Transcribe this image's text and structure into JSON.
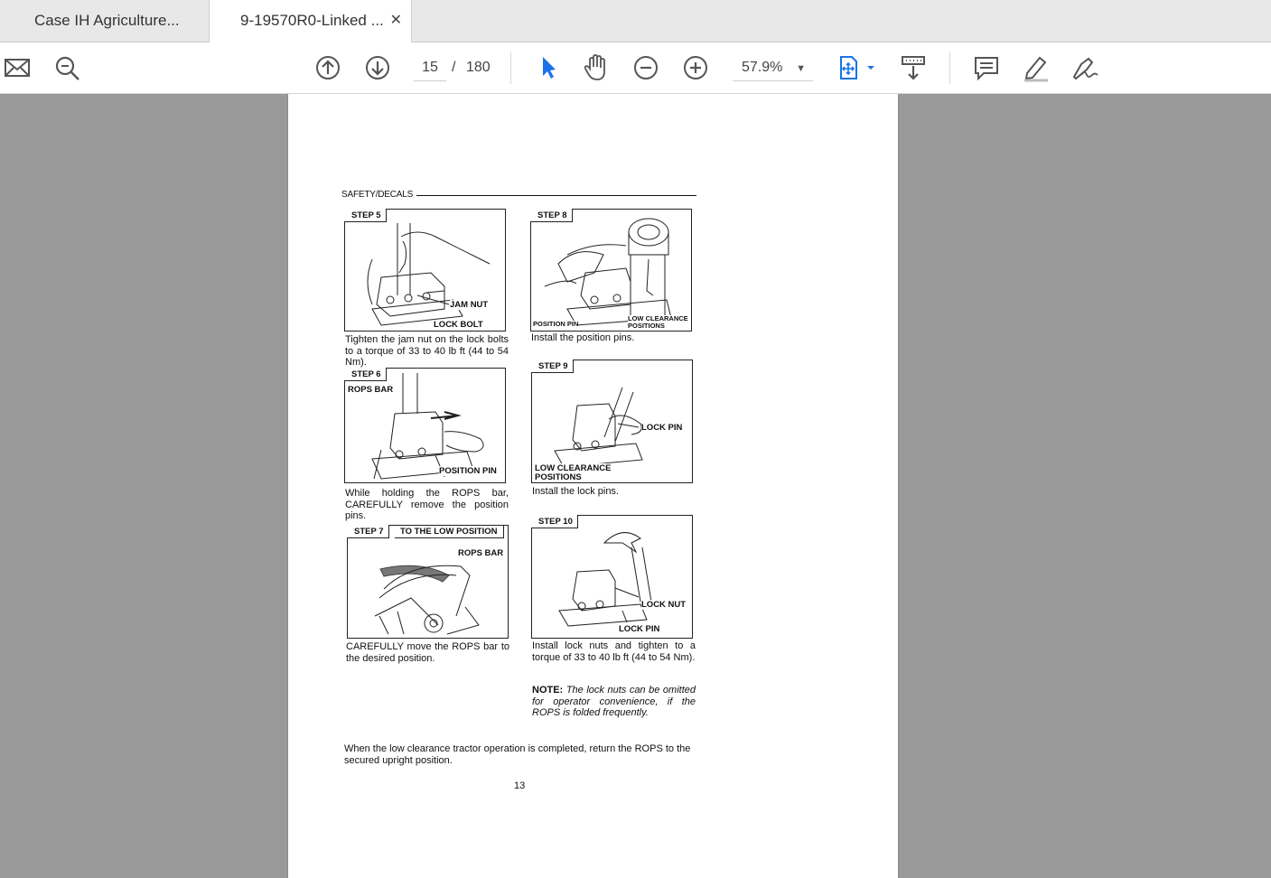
{
  "tabs": [
    {
      "label": "Case IH Agriculture..."
    },
    {
      "label": "9-19570R0-Linked ...",
      "close": "✕"
    }
  ],
  "toolbar": {
    "icons": [
      "mail-icon",
      "search-zoom-icon",
      "page-up-icon",
      "page-down-icon",
      "select-cursor-icon",
      "hand-tool-icon",
      "zoom-out-icon",
      "zoom-in-icon",
      "fit-page-icon",
      "scroll-mode-icon",
      "comment-icon",
      "highlight-pen-icon",
      "sign-icon"
    ],
    "current_page": "15",
    "page_sep": "/",
    "total_pages": "180",
    "zoom": "57.9%",
    "zoom_caret": "▼"
  },
  "document": {
    "header": "SAFETY/DECALS",
    "page_number": "13",
    "figures": [
      {
        "step": "STEP 5",
        "labels": [
          "JAM NUT",
          "LOCK BOLT"
        ],
        "caption": "Tighten the jam nut on the lock bolts to a torque of 33 to 40 lb ft (44 to 54 Nm)."
      },
      {
        "step": "STEP 6",
        "labels": [
          "ROPS BAR",
          "POSITION PIN"
        ],
        "caption": "While holding the ROPS bar, CAREFULLY remove the position pins."
      },
      {
        "step": "STEP 7",
        "step_extra": "TO THE LOW POSITION",
        "labels": [
          "ROPS BAR"
        ],
        "caption": "CAREFULLY move the ROPS bar to the desired position."
      },
      {
        "step": "STEP 8",
        "labels": [
          "POSITION PIN",
          "LOW CLEARANCE",
          "POSITIONS"
        ],
        "caption": "Install the position pins."
      },
      {
        "step": "STEP 9",
        "labels": [
          "LOCK PIN",
          "LOW CLEARANCE",
          "POSITIONS"
        ],
        "caption": "Install the lock pins."
      },
      {
        "step": "STEP 10",
        "labels": [
          "LOCK NUT",
          "LOCK PIN"
        ],
        "caption": "Install lock nuts and tighten to a torque of 33 to 40 lb ft (44 to 54 Nm)."
      }
    ],
    "note_label": "NOTE:",
    "note_text": "The lock nuts can be omitted for operator convenience, if the ROPS is folded frequently.",
    "footer_text": "When the low clearance tractor operation is completed, return the ROPS to the secured upright position."
  },
  "colors": {
    "accent": "#1a73e8",
    "viewer_bg": "#999999",
    "toolbar_bg": "#ffffff"
  }
}
